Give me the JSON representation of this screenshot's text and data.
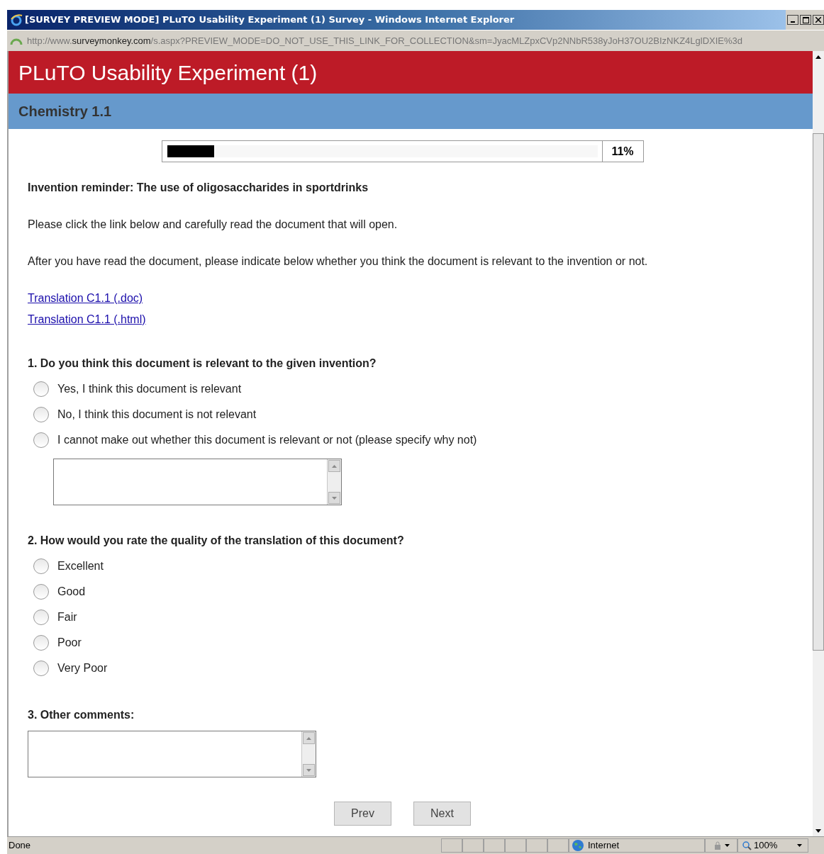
{
  "window": {
    "title": "[SURVEY PREVIEW MODE] PLuTO Usability Experiment (1) Survey - Windows Internet Explorer"
  },
  "address_bar": {
    "url_start": "http://www.",
    "url_host": "surveymonkey.com",
    "url_rest": "/s.aspx?PREVIEW_MODE=DO_NOT_USE_THIS_LINK_FOR_COLLECTION&sm=JyacMLZpxCVp2NNbR538yJoH37OU2BIzNKZ4LglDXIE%3d"
  },
  "survey": {
    "title": "PLuTO Usability Experiment (1)",
    "page_title": "Chemistry 1.1",
    "progress": {
      "level": 0.11,
      "reading": "11%"
    },
    "intro": "Invention reminder: The use of oligosaccharides in sportdrinks",
    "paragraphs": [
      "Please click the link below and carefully read the document that will open.",
      "After you have read the document, please indicate below whether you think the document is relevant to the invention or not."
    ],
    "links": [
      "Translation C1.1 (.doc)",
      "Translation C1.1 (.html)"
    ],
    "questions": [
      {
        "kind": "choice",
        "title": "1. Do you think this document is relevant to the given invention?",
        "options": [
          {
            "label": "Yes, I think this document is relevant",
            "selected": false
          },
          {
            "label": "No, I think this document is not relevant",
            "selected": false
          },
          {
            "label": "I cannot make out whether this document is relevant or not (please specify why not)",
            "selected": false
          }
        ],
        "comment_box": true
      },
      {
        "kind": "choice",
        "title": "2. How would you rate the quality of the translation of this document?",
        "options": [
          {
            "label": "Excellent",
            "selected": false
          },
          {
            "label": "Good",
            "selected": false
          },
          {
            "label": "Fair",
            "selected": false
          },
          {
            "label": "Poor",
            "selected": false
          },
          {
            "label": "Very Poor",
            "selected": false
          }
        ]
      },
      {
        "kind": "text",
        "title": "3. Other comments:"
      }
    ],
    "buttons": [
      "Prev",
      "Next"
    ]
  },
  "status_bar": {
    "status": "Done",
    "zone": "Internet",
    "zoom": "100%"
  }
}
